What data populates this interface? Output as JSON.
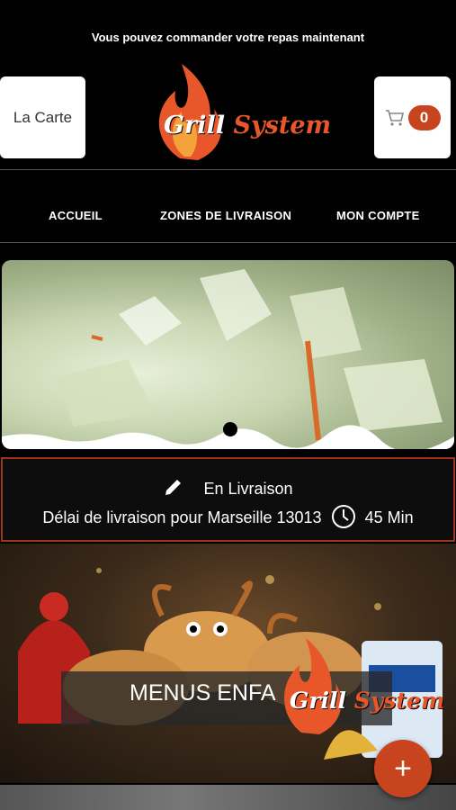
{
  "header": {
    "promo_text": "Vous pouvez commander votre repas maintenant",
    "carte_label": "La Carte",
    "logo_text_1": "Grill",
    "logo_text_2": "System",
    "cart_count": "0"
  },
  "nav": {
    "items": [
      {
        "label": "ACCUEIL"
      },
      {
        "label": "ZONES DE LIVRAISON"
      },
      {
        "label": "MON COMPTE"
      }
    ]
  },
  "delivery": {
    "status": "En Livraison",
    "info": "Délai de livraison pour Marseille 13013",
    "time": "45 Min"
  },
  "menu": {
    "label": "MENUS ENFA",
    "logo_text_1": "Grill",
    "logo_text_2": "System"
  },
  "fab": {
    "label": "+"
  },
  "colors": {
    "accent": "#c8441f",
    "border": "#a3321b"
  }
}
